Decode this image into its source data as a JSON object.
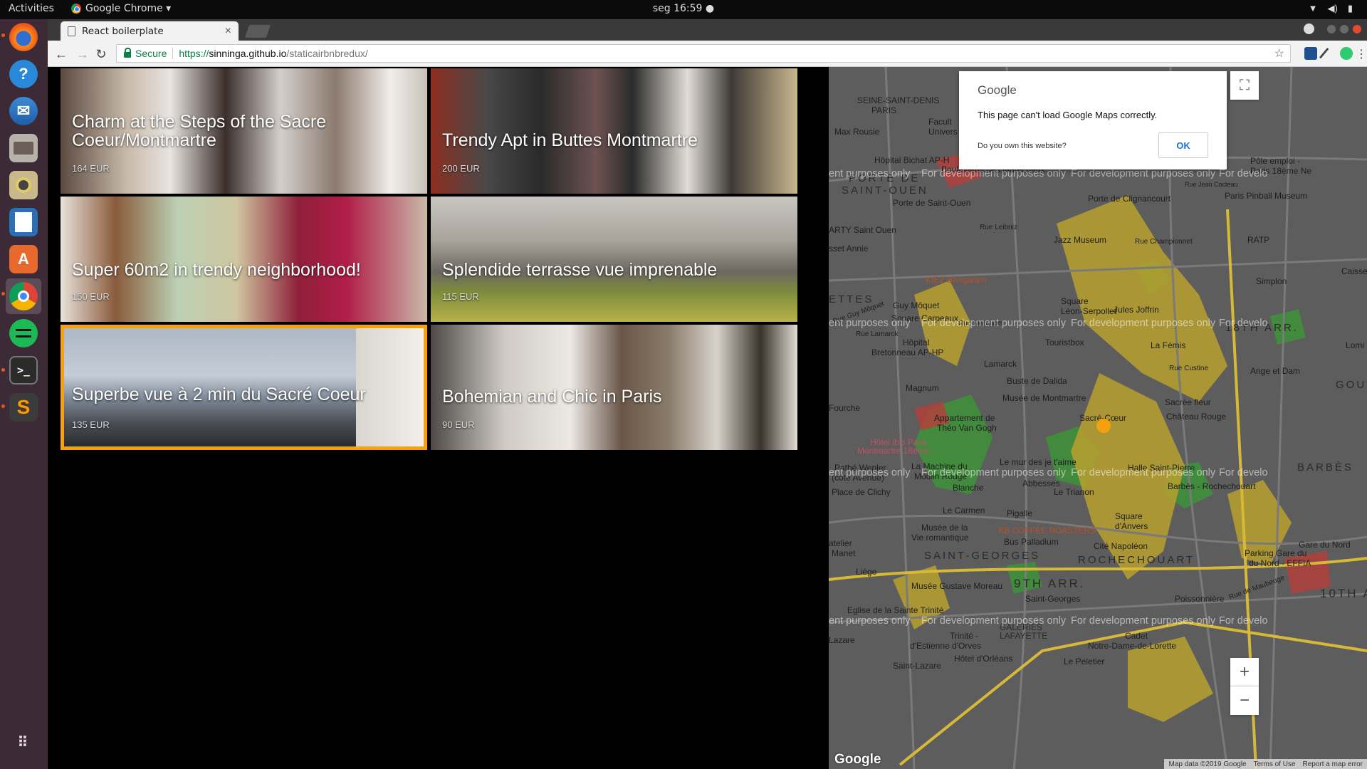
{
  "system_bar": {
    "activities": "Activities",
    "app_name": "Google Chrome ▾",
    "clock": "seg 16:59 ●",
    "tray": [
      "▼",
      "◀)",
      "▮"
    ]
  },
  "dock": {
    "items": [
      "firefox",
      "help",
      "thunderbird",
      "files",
      "rhythmbox",
      "libreoffice-writer",
      "software-center",
      "chrome",
      "spotify",
      "terminal",
      "sublime-text",
      "show-apps"
    ]
  },
  "browser": {
    "tab_title": "React boilerplate",
    "tab_close": "×",
    "back": "←",
    "forward": "→",
    "reload": "↻",
    "secure_label": "Secure",
    "url_scheme": "https://",
    "url_host": "sinninga.github.io",
    "url_path": "/staticairbnbredux/",
    "bookmark_star": "☆",
    "menu": "⋮"
  },
  "listings": [
    {
      "title": "Charm at the Steps of the Sacre Coeur/Montmartre",
      "price": "164 EUR"
    },
    {
      "title": "Trendy Apt in Buttes Montmartre",
      "price": "200 EUR"
    },
    {
      "title": "Super 60m2 in trendy neighborhood!",
      "price": "150 EUR"
    },
    {
      "title": "Splendide terrasse vue imprenable",
      "price": "115 EUR"
    },
    {
      "title": "Superbe vue à 2 min du Sacré Coeur",
      "price": "135 EUR"
    },
    {
      "title": "Bohemian and Chic in Paris",
      "price": "90 EUR"
    }
  ],
  "selected_listing": 4,
  "map": {
    "dialog_logo": "Google",
    "dialog_message": "This page can't load Google Maps correctly.",
    "dialog_question": "Do you own this website?",
    "dialog_ok": "OK",
    "dev_watermark": "For development purposes only",
    "dev_watermark_partial_left": "ent purposes only",
    "dev_watermark_partial_right": "For develo",
    "fullscreen_icon": "⛶",
    "zoom_in": "+",
    "zoom_out": "−",
    "logo": "Google",
    "attribution": [
      "Map data ©2019 Google",
      "Terms of Use",
      "Report a map error"
    ],
    "labels": {
      "saint_denis": "SEINE-SAINT-DENIS",
      "paris_top": "PARIS",
      "max_rousie": "Max Rousie",
      "faculte": "Facult",
      "univers": "Univers",
      "hopital_bichat": "Hôpital Bichat AP-H",
      "porte_de": "PORTE DE",
      "saint_ouen": "SAINT-OUEN",
      "boulevards": "Boulevards des Maréchaux",
      "porte_saint_ouen": "Porte de Saint-Ouen",
      "porte_clignancourt": "Porte de Clignancourt",
      "paris_pinball": "Paris Pinball Museum",
      "pole_emploi": "Pôle emploi -",
      "paris_18eme_ne": "Paris 18ème Ne",
      "rue_jean_cocteau": "Rue Jean Cocteau",
      "arty_saint_ouen": "ARTY Saint Ouen",
      "rue_leibniz": "Rue Leibniz",
      "jazz_museum": "Jazz Museum",
      "rue_championnet": "Rue Championnet",
      "ratp": "RATP",
      "caisse": "Caisse",
      "sset_annie": "sset Annie",
      "kiez": "KIEZ Biergarten",
      "simplon": "Simplon",
      "ettes": "ETTES",
      "guy_moquet": "Guy Môquet",
      "rue_guy_moquet": "Rue Guy Môquet",
      "square_leon": "Square",
      "leon_serpollet": "Léon-Serpollet",
      "jules_joffrin": "Jules Joffrin",
      "square_carpeaux": "Square Carpeaux",
      "rue_marcadet": "Rue Marcadet",
      "arr18": "18TH ARR.",
      "rue_lamarck": "Rue Lamarck",
      "touristbox": "Touristbox",
      "la_femis": "La Fémis",
      "lomi": "Lomi",
      "hopital_bretonneau": "Hôpital",
      "bretonneau": "Bretonneau AP-HP",
      "lamarck": "Lamarck",
      "rue_custine": "Rue Custine",
      "ange_et_dam": "Ange et Dam",
      "magnum": "Magnum",
      "buste_dalida": "Buste de Dalida",
      "gout": "GOUT",
      "fourche": "Fourche",
      "musee_montmartre": "Musée de Montmartre",
      "sacre_coeur": "Sacré-Cœur",
      "sacree_fleur": "Sacrée fleur",
      "appart_van_gogh": "Appartement de",
      "theo_van_gogh": "Théo Van Gogh",
      "chateau_rouge": "Château Rouge",
      "hotel_ibis": "Hôtel ibis Paris",
      "montmartre_18eme": "Montmartre 18ème",
      "path_wepler": "Pathé Wepler",
      "cote_avenue": "(côté Avenue)",
      "la_machine": "La Machine du",
      "moulin_rouge": "Moulin Rouge",
      "mur_je_taime": "Le mur des je t'aime",
      "abbesses": "Abbesses",
      "halle_saint_pierre": "Halle Saint-Pierre",
      "barbes": "BARBÈS",
      "place_clichy": "Place de Clichy",
      "blanche": "Blanche",
      "le_trianon": "Le Trianon",
      "barbes_rochechouart": "Barbès - Rochechouart",
      "le_carmen": "Le Carmen",
      "pigalle": "Pigalle",
      "square_anvers": "Square",
      "d_anvers": "d'Anvers",
      "musee_vie": "Musée de la",
      "vie_romantique": "Vie romantique",
      "kb_coffee": "KB COFFEE ROASTERS",
      "bus_palladium": "Bus Palladium",
      "cite_napoleon": "Cité Napoléon",
      "parking_gare": "Parking Gare du",
      "nord_effia": "du Nord - EFFIA",
      "gare_du_nord": "Gare du Nord",
      "atelier": "atelier",
      "manet": "Manet",
      "saint_georges": "SAINT-GEORGES",
      "rochechouart": "ROCHECHOUART",
      "liege": "Liège",
      "musee_gustave_moreau": "Musée Gustave Moreau",
      "arr9": "9TH ARR.",
      "arr10": "10TH A",
      "saint_georges_metro": "Saint-Georges",
      "poissonniere": "Poissonnière",
      "eglise_trinite": "Eglise de la Sainte Trinité",
      "galeries": "GALERIES",
      "lafayette": "LAFAYETTE",
      "cadet": "Cadet",
      "notre_dame_lorette": "Notre-Dame-de-Lorette",
      "trinite_estienne": "Trinité -",
      "estienne_dorves": "d'Estienne d'Orves",
      "lazare": "Lazare",
      "hotel_orleans": "Hôtel d'Orléans",
      "le_peletier": "Le Peletier",
      "saint_lazare": "Saint-Lazare",
      "rue_maubeuge": "Rue de Maubeuge"
    }
  },
  "colors": {
    "selected_border": "#f5a00f",
    "map_bg": "#5d5d5d",
    "park": "#3f8f3a",
    "road_major": "#c9a83a"
  }
}
